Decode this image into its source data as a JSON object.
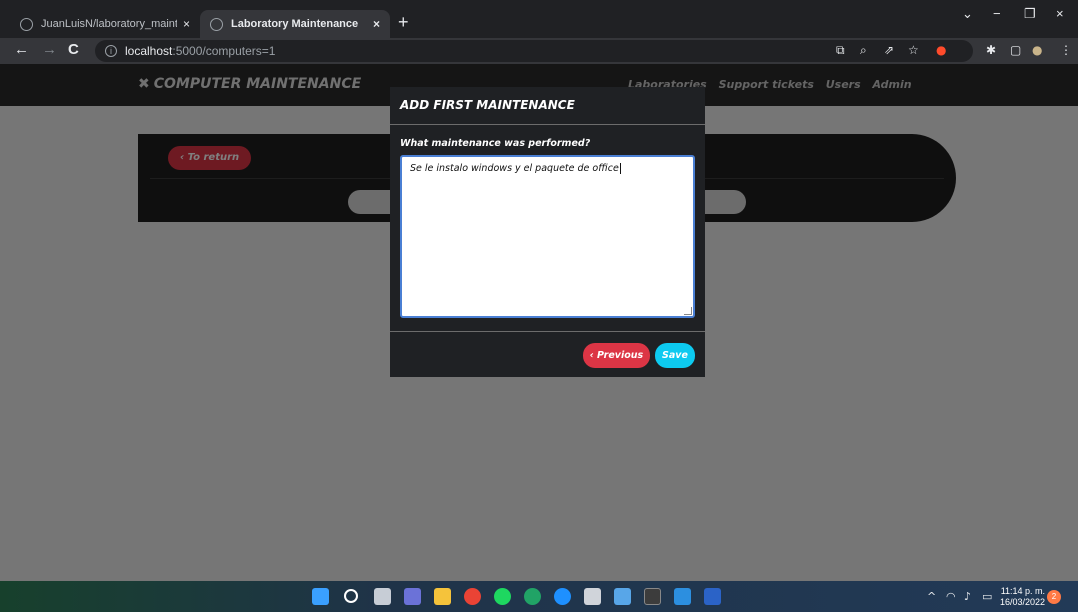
{
  "browser": {
    "tabs": [
      {
        "title": "JuanLuisN/laboratory_maintenan",
        "active": false
      },
      {
        "title": "Laboratory Maintenance",
        "active": true
      }
    ],
    "tab_close": "×",
    "new_tab": "+",
    "window_controls": {
      "minimize": "−",
      "restore": "❐",
      "close": "×",
      "tab_search": "⌄"
    },
    "nav": {
      "back": "←",
      "forward": "→",
      "reload": "C"
    },
    "url": {
      "host": "localhost",
      "path": ":5000/computers=1"
    },
    "info_glyph": "i"
  },
  "app": {
    "brand": "COMPUTER MAINTENANCE",
    "brand_icon": "✖",
    "nav_links": [
      "Laboratories",
      "Support tickets",
      "Users",
      "Admin"
    ]
  },
  "page": {
    "return_label": "‹ To return"
  },
  "modal": {
    "title": "ADD FIRST MAINTENANCE",
    "question": "What maintenance was performed?",
    "answer": "Se le instalo windows y el paquete de office",
    "previous_label": "‹ Previous",
    "save_label": "Save"
  },
  "taskbar": {
    "time": "11:14 p. m.",
    "date": "16/03/2022",
    "notifications": "2",
    "tray_chevron": "^"
  },
  "colors": {
    "danger": "#dc3545",
    "info": "#0dcaf0",
    "modal_bg": "#1f2124",
    "nav_bg": "#2b2b2b"
  }
}
